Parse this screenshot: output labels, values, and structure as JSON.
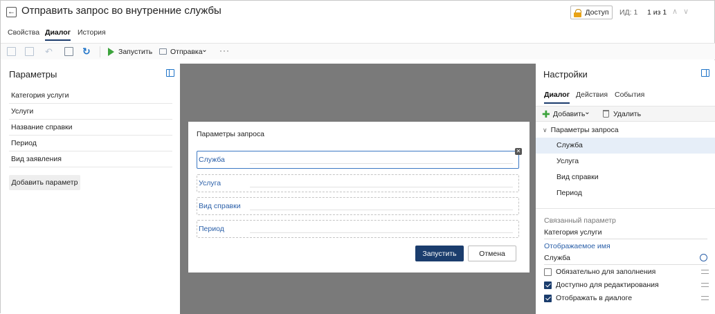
{
  "header": {
    "back_glyph": "←",
    "title": "Отправить запрос во внутренние службы",
    "star_glyph": "☆",
    "access_label": "Доступ",
    "id_label": "ИД: 1",
    "pager": "1 из 1",
    "prev_glyph": "∧",
    "next_glyph": "∨"
  },
  "tabs": [
    {
      "label": "Свойства",
      "active": false
    },
    {
      "label": "Диалог",
      "active": true
    },
    {
      "label": "История",
      "active": false
    }
  ],
  "toolbar": {
    "refresh_glyph": "↻",
    "run_label": "Запустить",
    "send_label": "Отправка",
    "send_chevron": "⌄",
    "more": "···",
    "icons": [
      "save-icon",
      "save-all-icon",
      "undo-icon",
      "copy-icon",
      "refresh-icon",
      "play-icon",
      "send-icon",
      "more-icon"
    ]
  },
  "left_panel": {
    "title": "Параметры",
    "params": [
      "Категория услуги",
      "Услуги",
      "Название справки",
      "Период",
      "Вид заявления"
    ],
    "add_button": "Добавить параметр"
  },
  "dialog": {
    "title": "Параметры запроса",
    "fields": [
      {
        "label": "Служба",
        "selected": true
      },
      {
        "label": "Услуга",
        "selected": false
      },
      {
        "label": "Вид справки",
        "selected": false
      },
      {
        "label": "Период",
        "selected": false
      }
    ],
    "close_glyph": "✕",
    "run_button": "Запустить",
    "cancel_button": "Отмена"
  },
  "right_panel": {
    "title": "Настройки",
    "tabs": [
      {
        "label": "Диалог",
        "active": true
      },
      {
        "label": "Действия",
        "active": false
      },
      {
        "label": "События",
        "active": false
      }
    ],
    "add_label": "Добавить",
    "add_chevron": "⌄",
    "plus_glyph": "✚",
    "delete_label": "Удалить",
    "tree_root": "Параметры запроса",
    "tree_caret": "∨",
    "tree_items": [
      "Служба",
      "Услуга",
      "Вид справки",
      "Период"
    ],
    "selected_item": "Служба",
    "linked_param_label": "Связанный параметр",
    "linked_param_value": "Категория услуги",
    "display_name_label": "Отображаемое имя",
    "display_name_value": "Служба",
    "checkboxes": [
      {
        "label": "Обязательно для заполнения",
        "checked": false
      },
      {
        "label": "Доступно для редактирования",
        "checked": true
      },
      {
        "label": "Отображать в диалоге",
        "checked": true
      }
    ]
  },
  "colors": {
    "accent": "#1b3d6d",
    "link": "#2a5fa8",
    "canvas": "#7a7a7a",
    "play": "#3ca33c",
    "selected_row": "#e6eef8"
  }
}
